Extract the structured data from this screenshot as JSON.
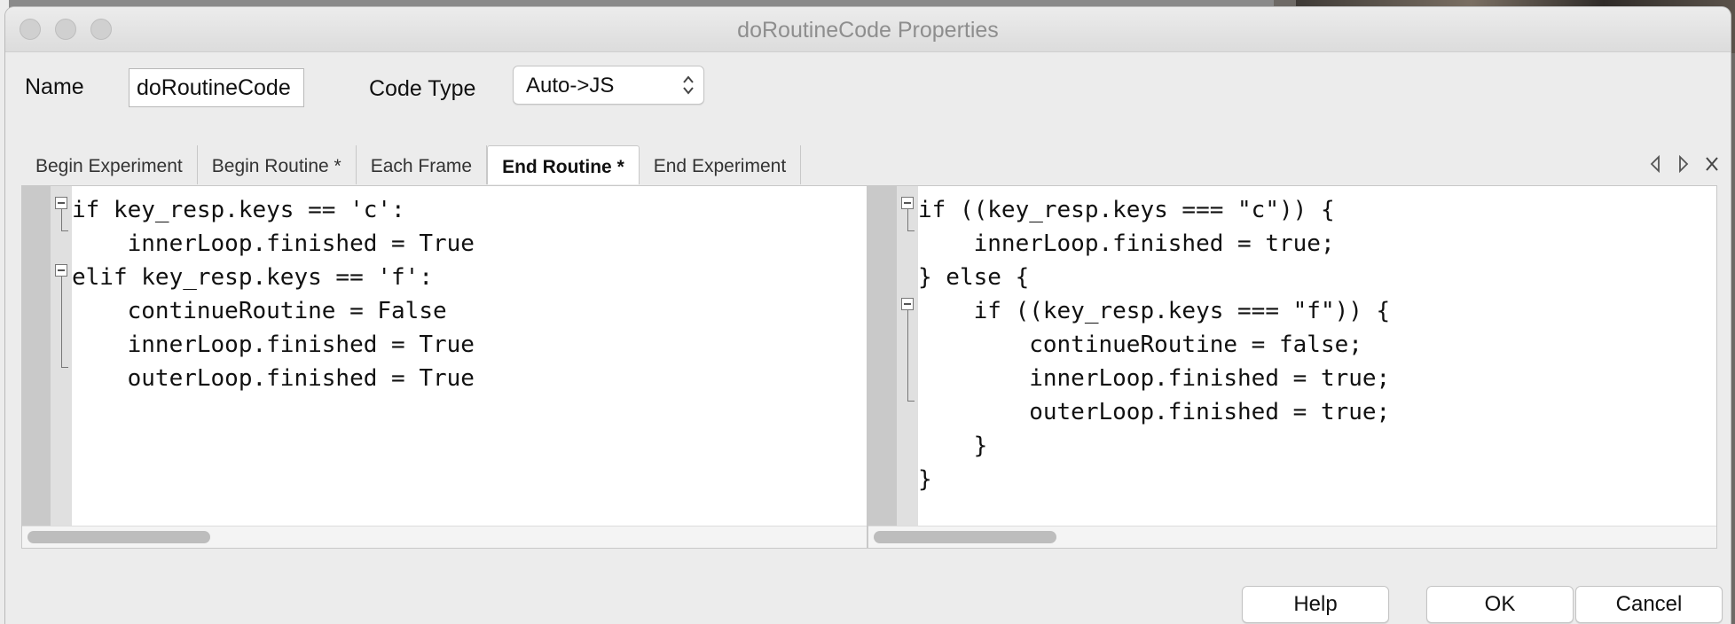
{
  "window": {
    "title": "doRoutineCode Properties"
  },
  "form": {
    "name_label": "Name",
    "name_value": "doRoutineCode",
    "code_type_label": "Code Type",
    "code_type_value": "Auto->JS"
  },
  "tabs": [
    {
      "label": "Begin Experiment"
    },
    {
      "label": "Begin Routine *"
    },
    {
      "label": "Each Frame"
    },
    {
      "label": "End Routine *",
      "active": true
    },
    {
      "label": "End Experiment"
    }
  ],
  "editor_python": {
    "lines": [
      "if key_resp.keys == 'c':",
      "    innerLoop.finished = True",
      "elif key_resp.keys == 'f':",
      "    continueRoutine = False",
      "    innerLoop.finished = True",
      "    outerLoop.finished = True"
    ]
  },
  "editor_js": {
    "lines": [
      "if ((key_resp.keys === \"c\")) {",
      "    innerLoop.finished = true;",
      "} else {",
      "    if ((key_resp.keys === \"f\")) {",
      "        continueRoutine = false;",
      "        innerLoop.finished = true;",
      "        outerLoop.finished = true;",
      "    }",
      "}"
    ]
  },
  "buttons": {
    "help": "Help",
    "ok": "OK",
    "cancel": "Cancel"
  },
  "icons": [
    "tab-scroll-left-icon",
    "tab-scroll-right-icon",
    "close-tab-icon"
  ]
}
